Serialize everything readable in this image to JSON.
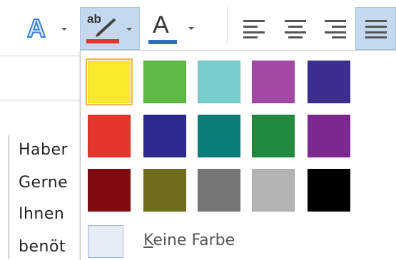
{
  "toolbar": {
    "text_effects_letter": "A",
    "highlight_letters": "ab",
    "highlight_color": "#e8322b",
    "font_color_letter": "A",
    "font_color_bar": "#2f6fc1"
  },
  "document": {
    "lines": [
      "Haber",
      "Gerne",
      "Ihnen",
      "benöt"
    ]
  },
  "palette": {
    "colors": [
      "#fbe92e",
      "#5cb946",
      "#79cccd",
      "#a24aa3",
      "#3a2f8f",
      "#e4352b",
      "#2c2a8e",
      "#0b7d7b",
      "#218a3e",
      "#7b2890",
      "#7f0a10",
      "#6f6e1e",
      "#777777",
      "#b3b3b3",
      "#000000"
    ],
    "selected_index": 0,
    "no_color_mnemonic": "K",
    "no_color_rest": "eine Farbe"
  }
}
